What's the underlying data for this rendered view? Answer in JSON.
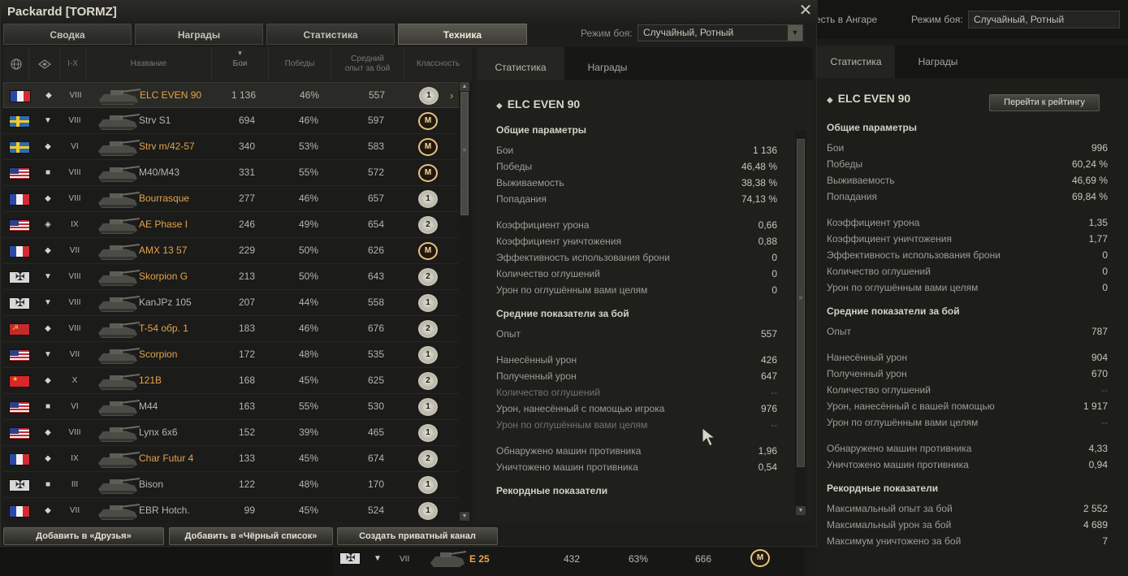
{
  "window": {
    "title": "Packardd [TORMZ]",
    "close_glyph": "✕"
  },
  "tabs": [
    {
      "label": "Сводка"
    },
    {
      "label": "Награды"
    },
    {
      "label": "Статистика"
    },
    {
      "label": "Техника",
      "active": true
    }
  ],
  "filter": {
    "mode_label": "Режим боя:",
    "mode_value": "Случайный, Ротный"
  },
  "table": {
    "headers": {
      "nation_icon": "globe-icon",
      "type_icon": "vehicle-type-icon",
      "tier": "I-X",
      "name": "Название",
      "battles": "Бои",
      "wins": "Победы",
      "avg_xp": "Средний опыт за бой",
      "mastery": "Классность"
    },
    "rows": [
      {
        "nation": "fr",
        "type": "◆",
        "tier": "VIII",
        "name": "ELC EVEN 90",
        "battles": "1 136",
        "wins": "46%",
        "xp": "557",
        "mastery": "1",
        "gold": true,
        "selected": true
      },
      {
        "nation": "se",
        "type": "▼",
        "tier": "VIII",
        "name": "Strv S1",
        "battles": "694",
        "wins": "46%",
        "xp": "597",
        "mastery": "M",
        "gold": false
      },
      {
        "nation": "se",
        "type": "◆",
        "tier": "VI",
        "name": "Strv m/42-57",
        "battles": "340",
        "wins": "53%",
        "xp": "583",
        "mastery": "M",
        "gold": true
      },
      {
        "nation": "us",
        "type": "■",
        "tier": "VIII",
        "name": "M40/M43",
        "battles": "331",
        "wins": "55%",
        "xp": "572",
        "mastery": "M",
        "gold": false
      },
      {
        "nation": "fr",
        "type": "◆",
        "tier": "VIII",
        "name": "Bourrasque",
        "battles": "277",
        "wins": "46%",
        "xp": "657",
        "mastery": "1",
        "gold": true
      },
      {
        "nation": "us",
        "type": "◈",
        "tier": "IX",
        "name": "AE Phase I",
        "battles": "246",
        "wins": "49%",
        "xp": "654",
        "mastery": "2",
        "gold": true
      },
      {
        "nation": "fr",
        "type": "◆",
        "tier": "VII",
        "name": "AMX 13 57",
        "battles": "229",
        "wins": "50%",
        "xp": "626",
        "mastery": "M",
        "gold": true
      },
      {
        "nation": "de",
        "type": "▼",
        "tier": "VIII",
        "name": "Skorpion G",
        "battles": "213",
        "wins": "50%",
        "xp": "643",
        "mastery": "2",
        "gold": true
      },
      {
        "nation": "de",
        "type": "▼",
        "tier": "VIII",
        "name": "KanJPz 105",
        "battles": "207",
        "wins": "44%",
        "xp": "558",
        "mastery": "1",
        "gold": false
      },
      {
        "nation": "ussr",
        "type": "◆",
        "tier": "VIII",
        "name": "T-54 обр. 1",
        "battles": "183",
        "wins": "46%",
        "xp": "676",
        "mastery": "2",
        "gold": true
      },
      {
        "nation": "us",
        "type": "▼",
        "tier": "VII",
        "name": "Scorpion",
        "battles": "172",
        "wins": "48%",
        "xp": "535",
        "mastery": "1",
        "gold": true
      },
      {
        "nation": "cn",
        "type": "◆",
        "tier": "X",
        "name": "121B",
        "battles": "168",
        "wins": "45%",
        "xp": "625",
        "mastery": "2",
        "gold": true
      },
      {
        "nation": "us",
        "type": "■",
        "tier": "VI",
        "name": "M44",
        "battles": "163",
        "wins": "55%",
        "xp": "530",
        "mastery": "1",
        "gold": false
      },
      {
        "nation": "us",
        "type": "◆",
        "tier": "VIII",
        "name": "Lynx 6x6",
        "battles": "152",
        "wins": "39%",
        "xp": "465",
        "mastery": "1",
        "gold": false
      },
      {
        "nation": "fr",
        "type": "◆",
        "tier": "IX",
        "name": "Char Futur 4",
        "battles": "133",
        "wins": "45%",
        "xp": "674",
        "mastery": "2",
        "gold": true
      },
      {
        "nation": "de",
        "type": "■",
        "tier": "III",
        "name": "Bison",
        "battles": "122",
        "wins": "48%",
        "xp": "170",
        "mastery": "1",
        "gold": false
      },
      {
        "nation": "fr",
        "type": "◆",
        "tier": "VII",
        "name": "EBR Hotch.",
        "battles": "99",
        "wins": "45%",
        "xp": "524",
        "mastery": "1",
        "gold": false
      }
    ]
  },
  "stats_panel": {
    "tabs": [
      "Статистика",
      "Награды"
    ],
    "vehicle_name": "ELC EVEN 90",
    "sections": [
      {
        "title": "Общие параметры",
        "rows": [
          {
            "label": "Бои",
            "value": "1 136"
          },
          {
            "label": "Победы",
            "value": "46,48 %"
          },
          {
            "label": "Выживаемость",
            "value": "38,38 %"
          },
          {
            "label": "Попадания",
            "value": "74,13 %"
          }
        ]
      },
      {
        "title": "",
        "rows": [
          {
            "label": "Коэффициент урона",
            "value": "0,66"
          },
          {
            "label": "Коэффициент уничтожения",
            "value": "0,88"
          },
          {
            "label": "Эффективность использования брони",
            "value": "0"
          },
          {
            "label": "Количество оглушений",
            "value": "0"
          },
          {
            "label": "Урон по оглушённым вами целям",
            "value": "0"
          }
        ]
      },
      {
        "title": "Средние показатели за бой",
        "rows": [
          {
            "label": "Опыт",
            "value": "557"
          }
        ]
      },
      {
        "title": "",
        "rows": [
          {
            "label": "Нанесённый урон",
            "value": "426"
          },
          {
            "label": "Полученный урон",
            "value": "647"
          },
          {
            "label": "Количество оглушений",
            "value": "--",
            "muted": true
          },
          {
            "label": "Урон, нанесённый с помощью игрока",
            "value": "976"
          },
          {
            "label": "Урон по оглушённым вами целям",
            "value": "--",
            "muted": true
          }
        ]
      },
      {
        "title": "",
        "rows": [
          {
            "label": "Обнаружено машин противника",
            "value": "1,96"
          },
          {
            "label": "Уничтожено машин противника",
            "value": "0,54"
          }
        ]
      },
      {
        "title": "Рекордные показатели",
        "rows": []
      }
    ]
  },
  "footer": {
    "add_friend": "Добавить в «Друзья»",
    "add_blacklist": "Добавить в «Чёрный список»",
    "private_channel": "Создать приватный канал"
  },
  "background": {
    "hangar_text": "есть в Ангаре",
    "mode_label": "Режим боя:",
    "mode_value": "Случайный, Ротный",
    "tabs": [
      "Статистика",
      "Награды"
    ],
    "vehicle_name": "ELC EVEN 90",
    "rating_button": "Перейти к рейтингу",
    "sections": [
      {
        "title": "Общие параметры",
        "rows": [
          {
            "label": "Бои",
            "value": "996"
          },
          {
            "label": "Победы",
            "value": "60,24 %"
          },
          {
            "label": "Выживаемость",
            "value": "46,69 %"
          },
          {
            "label": "Попадания",
            "value": "69,84 %"
          }
        ]
      },
      {
        "title": "",
        "rows": [
          {
            "label": "Коэффициент урона",
            "value": "1,35"
          },
          {
            "label": "Коэффициент уничтожения",
            "value": "1,77"
          },
          {
            "label": "Эффективность использования брони",
            "value": "0"
          },
          {
            "label": "Количество оглушений",
            "value": "0"
          },
          {
            "label": "Урон по оглушённым вами целям",
            "value": "0"
          }
        ]
      },
      {
        "title": "Средние показатели за бой",
        "rows": [
          {
            "label": "Опыт",
            "value": "787"
          }
        ]
      },
      {
        "title": "",
        "rows": [
          {
            "label": "Нанесённый урон",
            "value": "904"
          },
          {
            "label": "Полученный урон",
            "value": "670"
          },
          {
            "label": "Количество оглушений",
            "value": "--"
          },
          {
            "label": "Урон, нанесённый с вашей помощью",
            "value": "1 917"
          },
          {
            "label": "Урон по оглушённым вами целям",
            "value": "--"
          }
        ]
      },
      {
        "title": "",
        "rows": [
          {
            "label": "Обнаружено машин противника",
            "value": "4,33"
          },
          {
            "label": "Уничтожено машин противника",
            "value": "0,94"
          }
        ]
      },
      {
        "title": "Рекордные показатели",
        "rows": [
          {
            "label": "Максимальный опыт за бой",
            "value": "2 552"
          },
          {
            "label": "Максимальный урон за бой",
            "value": "4 689"
          },
          {
            "label": "Максимум уничтожено за бой",
            "value": "7"
          }
        ]
      }
    ],
    "tank_row": {
      "nation": "de",
      "type": "▼",
      "tier": "VII",
      "name": "E 25",
      "battles": "432",
      "wins": "63%",
      "xp": "666",
      "mastery": "M"
    }
  },
  "colors": {
    "accent_gold": "#e3a44c",
    "text": "#b9b7ae",
    "background": "#1d1d1b"
  }
}
